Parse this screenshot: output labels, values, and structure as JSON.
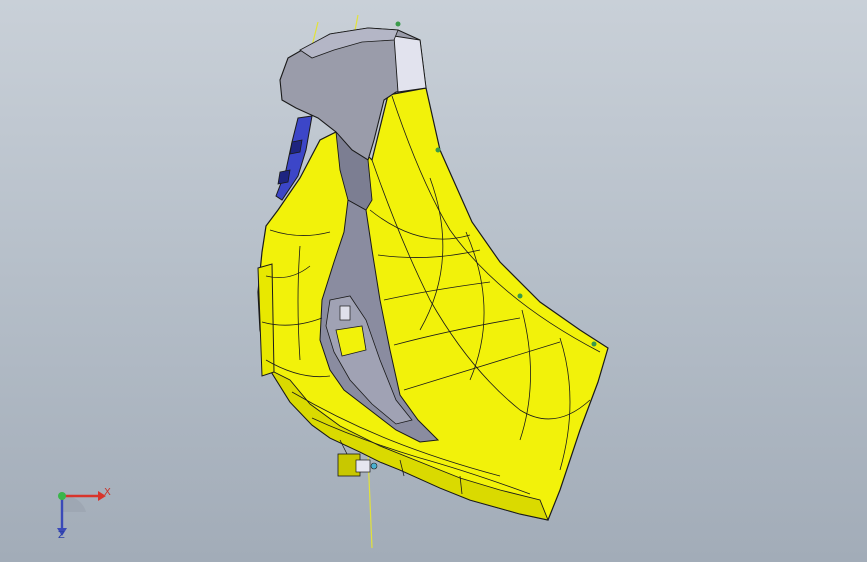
{
  "viewport": {
    "background_top": "#c9d0d8",
    "background_bottom": "#a2acb8"
  },
  "model": {
    "body_color": "#f2f20a",
    "body_shade": "#c8c800",
    "cap_color": "#9a9caa",
    "cap_light": "#d8d8e8",
    "inner_color": "#7c7e92",
    "bracket_color": "#3c46c8",
    "edge_color": "#1a1a1a",
    "axis_line_color": "#e2e23a"
  },
  "triad": {
    "x_label": "X",
    "z_label": "Z",
    "x_color": "#d8342b",
    "y_color": "#3ab54a",
    "z_color": "#3a49b8"
  }
}
